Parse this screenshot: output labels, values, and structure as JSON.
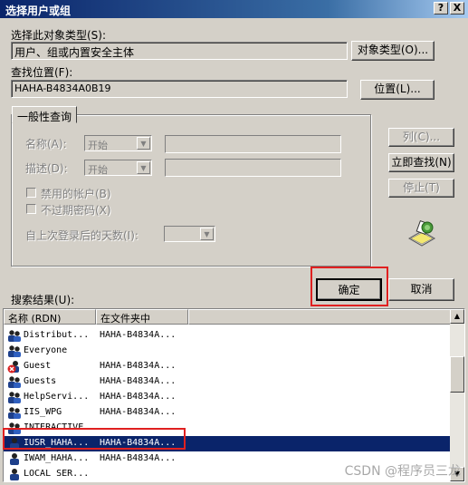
{
  "window": {
    "title": "选择用户或组",
    "help_btn": "?",
    "close_btn": "X"
  },
  "object_type": {
    "label": "选择此对象类型(S):",
    "value": "用户、组或内置安全主体",
    "button": "对象类型(O)..."
  },
  "location": {
    "label": "查找位置(F):",
    "value": "HAHA-B4834A0B19",
    "button": "位置(L)..."
  },
  "general_query": {
    "tab": "一般性查询",
    "name_label": "名称(A):",
    "name_combo": "开始",
    "desc_label": "描述(D):",
    "desc_combo": "开始",
    "disabled_accounts": "禁用的帐户(B)",
    "no_expire_pwd": "不过期密码(X)",
    "days_since_login": "自上次登录后的天数(I):"
  },
  "right_buttons": {
    "columns": "列(C)...",
    "find_now": "立即查找(N)",
    "stop": "停止(T)"
  },
  "actions": {
    "ok": "确定",
    "cancel": "取消"
  },
  "results": {
    "label": "搜索结果(U):",
    "columns": [
      "名称 (RDN)",
      "在文件夹中"
    ],
    "rows": [
      {
        "name": "Distribut...",
        "folder": "HAHA-B4834A...",
        "icon": "group-icon",
        "selected": false
      },
      {
        "name": "Everyone",
        "folder": "",
        "icon": "group-icon",
        "selected": false
      },
      {
        "name": "Guest",
        "folder": "HAHA-B4834A...",
        "icon": "disabled-user-icon",
        "selected": false
      },
      {
        "name": "Guests",
        "folder": "HAHA-B4834A...",
        "icon": "group-icon",
        "selected": false
      },
      {
        "name": "HelpServi...",
        "folder": "HAHA-B4834A...",
        "icon": "group-icon",
        "selected": false
      },
      {
        "name": "IIS_WPG",
        "folder": "HAHA-B4834A...",
        "icon": "group-icon",
        "selected": false
      },
      {
        "name": "INTERACTIVE",
        "folder": "",
        "icon": "group-icon",
        "selected": false
      },
      {
        "name": "IUSR_HAHA...",
        "folder": "HAHA-B4834A...",
        "icon": "user-icon",
        "selected": true
      },
      {
        "name": "IWAM_HAHA...",
        "folder": "HAHA-B4834A...",
        "icon": "user-icon",
        "selected": false
      },
      {
        "name": "LOCAL SER...",
        "folder": "",
        "icon": "user-icon",
        "selected": false
      }
    ]
  },
  "watermark": "CSDN @程序员三龙",
  "colors": {
    "highlight": "#e02020",
    "title_bar": "#0a246a",
    "selection": "#0a246a"
  }
}
